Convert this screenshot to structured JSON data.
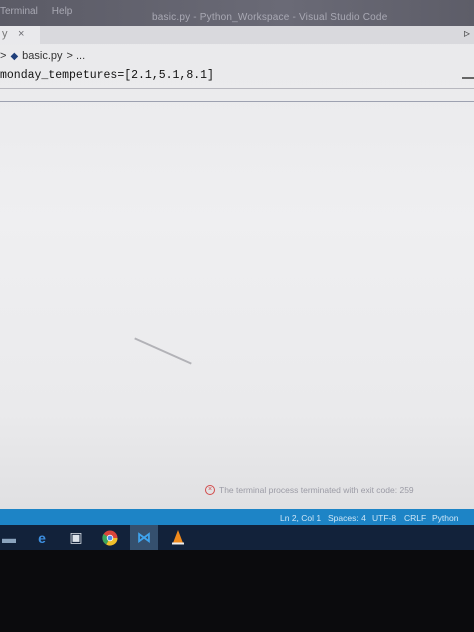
{
  "window": {
    "menu": [
      "Terminal",
      "Help"
    ],
    "title": "basic.py - Python_Workspace - Visual Studio Code"
  },
  "tab": {
    "name": "y",
    "close_glyph": "×"
  },
  "editor": {
    "breadcrumb_sep": ">",
    "breadcrumb_file": "basic.py",
    "breadcrumb_rest": "> ...",
    "code_line": "monday_tempetures=[2.1,5.1,8.1]"
  },
  "notification": {
    "text": "The terminal process terminated with exit code: 259"
  },
  "status_bar": {
    "position": "Ln 2, Col 1",
    "spaces": "Spaces: 4",
    "encoding": "UTF-8",
    "line_ending": "CRLF",
    "language": "Python"
  },
  "colors": {
    "status_bar": "#1d84c6",
    "taskbar": "#12223a",
    "error": "#d24b4b"
  }
}
